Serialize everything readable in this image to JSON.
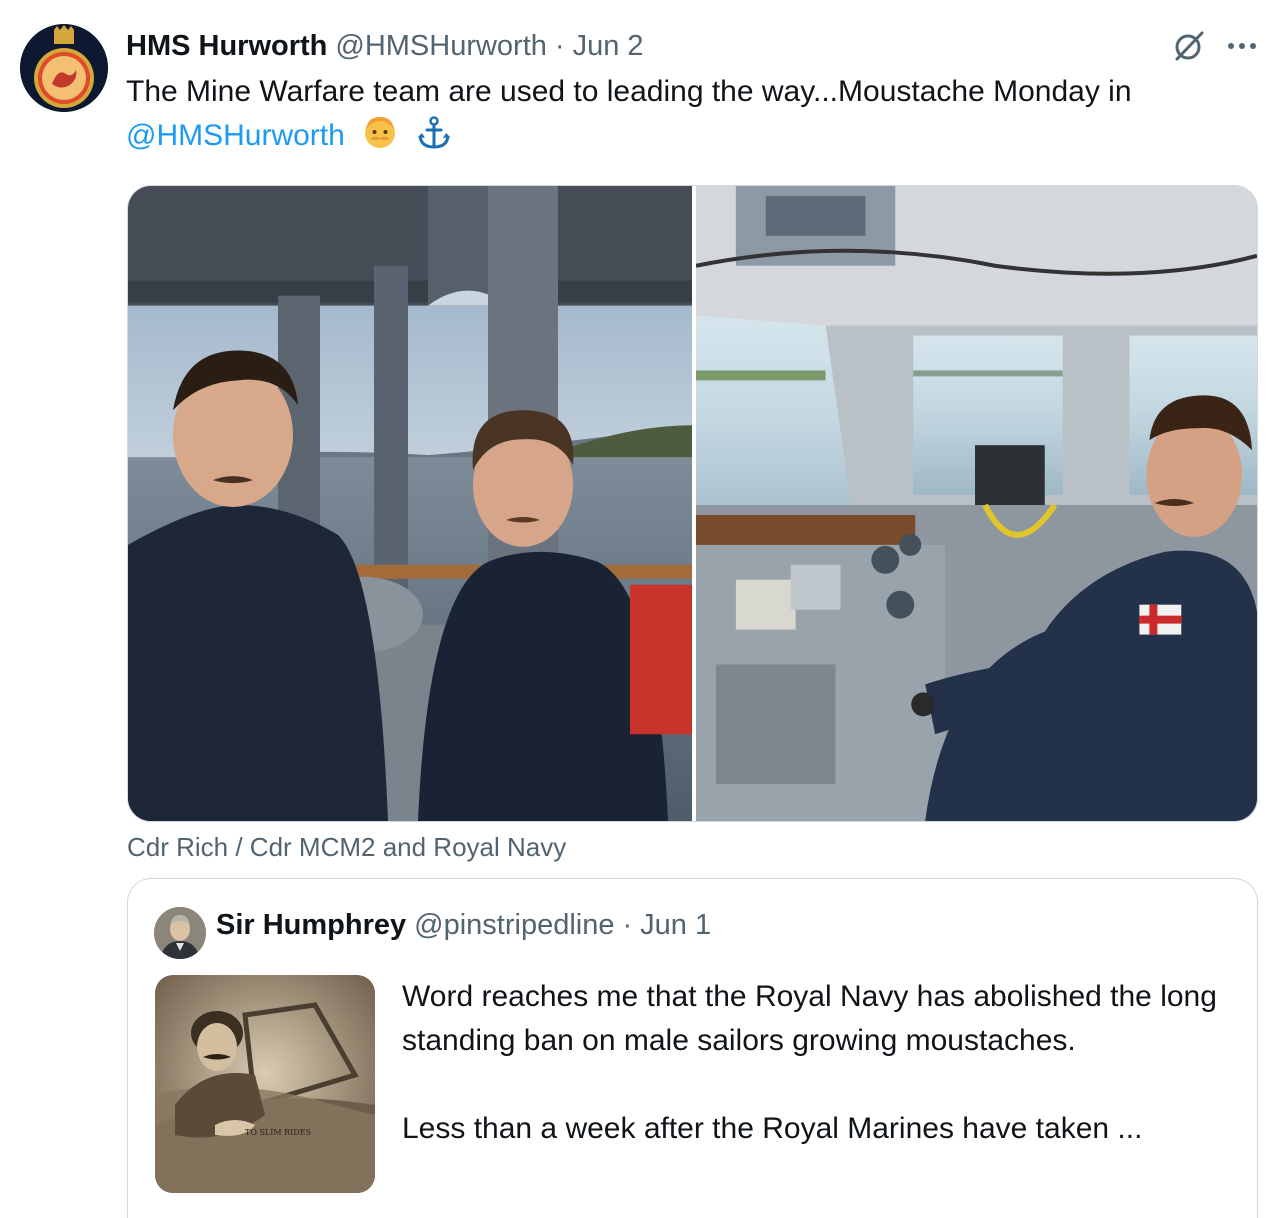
{
  "post": {
    "author_name": "HMS Hurworth",
    "author_handle": "@HMSHurworth",
    "dot": "·",
    "date": "Jun 2",
    "text_before_mention": "The Mine Warfare team are used to leading the way...Moustache Monday in ",
    "mention": "@HMSHurworth",
    "emoji_1": "person-with-moustache-emoji",
    "emoji_2": "anchor-emoji",
    "media_caption": "Cdr Rich / Cdr MCM2 and Royal Navy"
  },
  "quoted_post": {
    "author_name": "Sir Humphrey",
    "author_handle": "@pinstripedline",
    "dot": "·",
    "date": "Jun 1",
    "paragraph_1": "Word reaches me that the Royal Navy has abolished the long standing ban on male sailors growing moustaches.",
    "paragraph_2": "Less than a week after the Royal Marines have taken ..."
  },
  "colors": {
    "link": "#1d9bf0",
    "secondary_text": "#536471",
    "border": "#cfd9de"
  }
}
